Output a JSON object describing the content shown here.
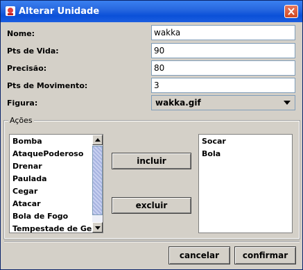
{
  "window": {
    "title": "Alterar Unidade"
  },
  "fields": {
    "nome": {
      "label": "Nome:",
      "value": "wakka"
    },
    "pts_vida": {
      "label": "Pts de Vida:",
      "value": "90"
    },
    "precisao": {
      "label": "Precisão:",
      "value": "80"
    },
    "pts_movimento": {
      "label": "Pts de Movimento:",
      "value": "3"
    },
    "figura": {
      "label": "Figura:",
      "value": "wakka.gif"
    }
  },
  "acoes": {
    "title": "Ações",
    "available": [
      "Bomba",
      "AtaquePoderoso",
      "Drenar",
      "Paulada",
      "Cegar",
      "Atacar",
      "Bola de Fogo",
      "Tempestade de Gelo"
    ],
    "selected": [
      "Socar",
      "Bola"
    ],
    "include_label": "incluir",
    "exclude_label": "excluir"
  },
  "buttons": {
    "cancel": "cancelar",
    "confirm": "confirmar"
  },
  "colors": {
    "titlebar": "#0a50d8",
    "close": "#d04820",
    "background": "#d4d0c8"
  },
  "icons": {
    "title": "app-icon",
    "close": "close-icon",
    "dropdown": "chevron-down-icon"
  }
}
